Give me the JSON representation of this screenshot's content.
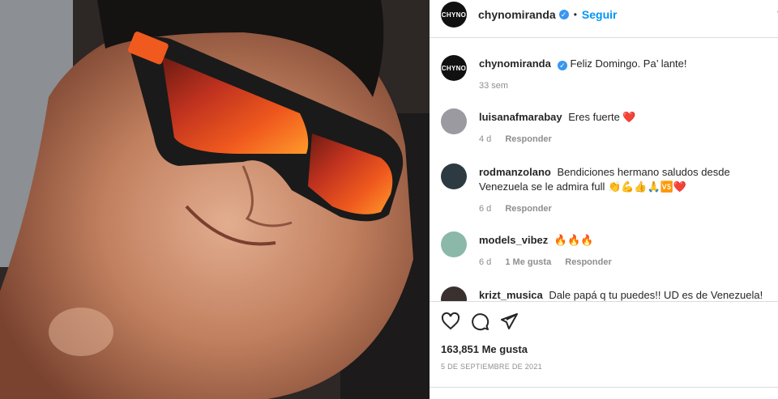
{
  "post": {
    "username": "chynomiranda",
    "avatar_text": "CHYNO",
    "follow_label": "Seguir",
    "more_label": "•",
    "caption": "Feliz Domingo. Pa’ lante!",
    "caption_time": "33 sem",
    "likes": "163,851 Me gusta",
    "date": "5 DE SEPTIEMBRE DE 2021"
  },
  "comments": [
    {
      "user": "luisanafmarabay",
      "text": "Eres fuerte ❤️",
      "time": "4 d",
      "likes": "",
      "reply": "Responder"
    },
    {
      "user": "rodmanzolano",
      "text": "Bendiciones hermano saludos desde Venezuela se le admira full 👏💪👍🙏🆚❤️",
      "time": "6 d",
      "likes": "",
      "reply": "Responder"
    },
    {
      "user": "models_vibez",
      "text": "🔥🔥🔥",
      "time": "6 d",
      "likes": "1 Me gusta",
      "reply": "Responder"
    },
    {
      "user": "krizt_musica",
      "text": "Dale papá q tu puedes!! UD es de Venezuela!",
      "time": "",
      "likes": "",
      "reply": ""
    }
  ],
  "icons": {
    "like": "heart-icon",
    "comment": "comment-icon",
    "share": "share-icon"
  },
  "colors": {
    "accent": "#0095f6",
    "verified": "#3897f0",
    "muted": "#8e8e8e"
  }
}
